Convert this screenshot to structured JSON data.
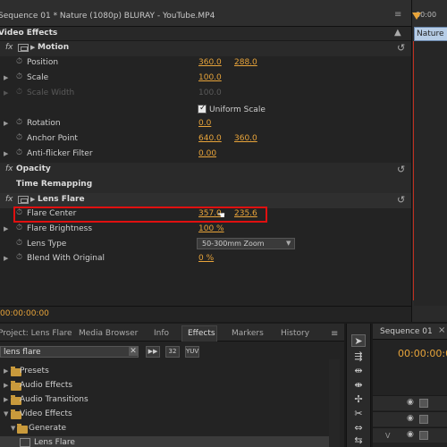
{
  "effect_controls": {
    "tab_title": "Sequence 01 * Nature (1080p) BLURAY - YouTube.MP4",
    "header": "Video Effects",
    "rows": {
      "motion": {
        "fx": "fx",
        "label": "Motion"
      },
      "position": {
        "label": "Position",
        "v1": "360.0",
        "v2": "288.0"
      },
      "scale": {
        "label": "Scale",
        "v1": "100.0"
      },
      "scale_width": {
        "label": "Scale Width",
        "v1": "100.0"
      },
      "uniform_scale": {
        "label": "Uniform Scale",
        "checked": true
      },
      "rotation": {
        "label": "Rotation",
        "v1": "0.0"
      },
      "anchor_point": {
        "label": "Anchor Point",
        "v1": "640.0",
        "v2": "360.0"
      },
      "anti_flicker": {
        "label": "Anti-flicker Filter",
        "v1": "0.00"
      },
      "opacity": {
        "fx": "fx",
        "label": "Opacity"
      },
      "time_remapping": {
        "label": "Time Remapping"
      },
      "lens_flare": {
        "fx": "fx",
        "label": "Lens Flare"
      },
      "flare_center": {
        "label": "Flare Center",
        "v1": "357.0",
        "v2": "235.6"
      },
      "flare_brightness": {
        "label": "Flare Brightness",
        "v1": "100 %"
      },
      "lens_type": {
        "label": "Lens Type",
        "value": "50-300mm Zoom"
      },
      "blend_with_original": {
        "label": "Blend With Original",
        "v1": "0 %"
      }
    },
    "current_time": "00:00:00:00"
  },
  "timeline_strip": {
    "time_label": "00:00",
    "clip_label": "Nature (1"
  },
  "project_panel": {
    "tabs": [
      "Project: Lens Flare",
      "Media Browser",
      "Info",
      "Effects",
      "Markers",
      "History"
    ],
    "active_tab": "Effects",
    "search_value": "lens flare",
    "buttons": [
      "32",
      "YUV"
    ],
    "tree": [
      {
        "label": "Presets",
        "expanded": false
      },
      {
        "label": "Audio Effects",
        "expanded": false
      },
      {
        "label": "Audio Transitions",
        "expanded": false
      },
      {
        "label": "Video Effects",
        "expanded": true
      },
      {
        "label": "Generate",
        "expanded": true
      },
      {
        "label": "Lens Flare",
        "selected": true
      }
    ]
  },
  "sequence_panel": {
    "tab_title": "Sequence 01",
    "timecode": "00:00:00:00",
    "track_label": "V"
  },
  "colors": {
    "accent_value": "#e8a43a",
    "highlight_box": "#e01010",
    "folder": "#c99a3c",
    "clip": "#b7cde6"
  },
  "icons": {
    "stopwatch": "stopwatch-icon",
    "reset": "reset-icon",
    "folder": "folder-icon",
    "eye": "eye-icon"
  }
}
